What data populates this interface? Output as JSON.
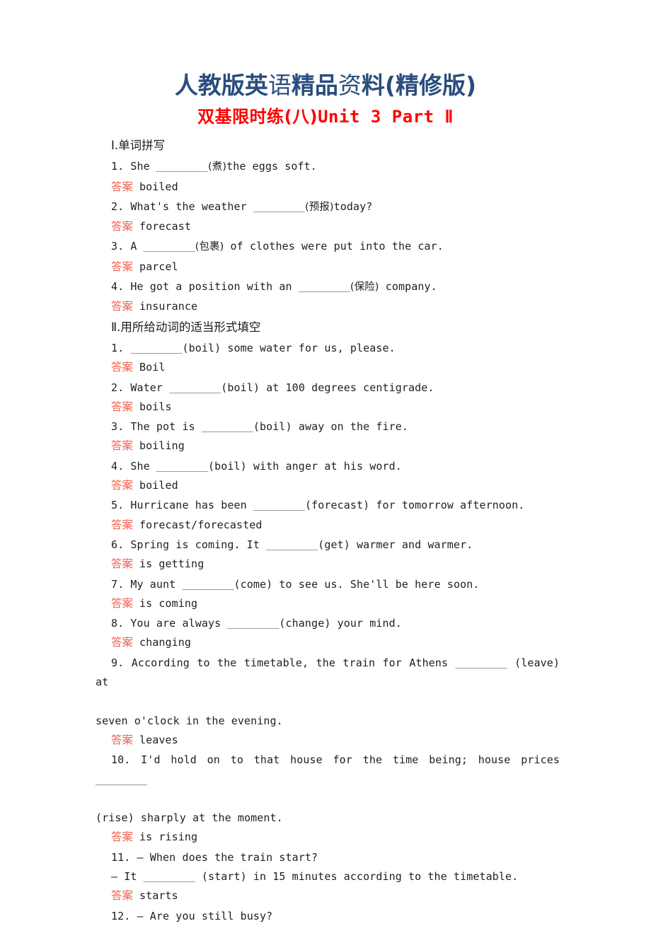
{
  "header": {
    "brand_part1": "人教版英",
    "brand_part2": "语",
    "brand_part3": "精品",
    "brand_part4": "资",
    "brand_part5": "料(精修版)",
    "brand_full": "人教版英语精品资料(精修版)",
    "exercise_title_zh": "双基限时练(八)",
    "exercise_title_en": "Unit 3  Part Ⅱ",
    "brand_color": "#2a4d7d",
    "title_color": "#ff0000",
    "answer_label_color": "#f4614f"
  },
  "sections": [
    {
      "number": "Ⅰ",
      "heading": "Ⅰ.单词拼写",
      "items": [
        {
          "q_prefix": "1. She ",
          "q_blank": "________",
          "q_mid": "(煮)",
          "q_suffix": "the eggs soft.",
          "answer_label": "答案",
          "answer": "boiled"
        },
        {
          "q_prefix": "2. What's the weather ",
          "q_blank": "________",
          "q_mid": "(预报)",
          "q_suffix": "today?",
          "answer_label": "答案",
          "answer": "forecast"
        },
        {
          "q_prefix": "3. A ",
          "q_blank": "________",
          "q_mid": "(包裹)",
          "q_suffix": " of clothes were put into the car.",
          "answer_label": "答案",
          "answer": "parcel"
        },
        {
          "q_prefix": "4. He got a position with an ",
          "q_blank": "________",
          "q_mid": "(保险)",
          "q_suffix": " company.",
          "answer_label": "答案",
          "answer": "insurance"
        }
      ]
    },
    {
      "number": "Ⅱ",
      "heading": "Ⅱ.用所给动词的适当形式填空",
      "items": [
        {
          "q_prefix": "1. ",
          "q_blank": "________",
          "q_mid": "(boil)",
          "q_suffix": " some water for us, please.",
          "answer_label": "答案",
          "answer": "Boil"
        },
        {
          "q_prefix": "2. Water ",
          "q_blank": "________",
          "q_mid": "(boil)",
          "q_suffix": " at 100 degrees centigrade.",
          "answer_label": "答案",
          "answer": "boils"
        },
        {
          "q_prefix": "3. The pot is ",
          "q_blank": "________",
          "q_mid": "(boil)",
          "q_suffix": " away on the fire.",
          "answer_label": "答案",
          "answer": "boiling"
        },
        {
          "q_prefix": "4. She ",
          "q_blank": "________",
          "q_mid": "(boil)",
          "q_suffix": " with anger at his word.",
          "answer_label": "答案",
          "answer": "boiled"
        },
        {
          "q_prefix": "5. Hurricane has been ",
          "q_blank": "________",
          "q_mid": "(forecast)",
          "q_suffix": " for tomorrow afternoon.",
          "answer_label": "答案",
          "answer": "forecast/forecasted"
        },
        {
          "q_prefix": "6. Spring is coming. It ",
          "q_blank": "________",
          "q_mid": "(get)",
          "q_suffix": " warmer and warmer.",
          "answer_label": "答案",
          "answer": "is getting"
        },
        {
          "q_prefix": "7. My aunt ",
          "q_blank": "________",
          "q_mid": "(come)",
          "q_suffix": " to see us. She'll be here soon.",
          "answer_label": "答案",
          "answer": "is coming"
        },
        {
          "q_prefix": "8. You are always ",
          "q_blank": "________",
          "q_mid": "(change)",
          "q_suffix": " your mind.",
          "answer_label": "答案",
          "answer": "changing"
        },
        {
          "q_line1_prefix": "9. According to the timetable, the train for Athens ",
          "q_line1_blank": "________",
          "q_line1_suffix": " (leave) at",
          "q_line2": "seven o'clock in the evening.",
          "answer_label": "答案",
          "answer": "leaves"
        },
        {
          "q_line1_prefix": "10. I'd hold on to that house for the time being; house prices ",
          "q_line1_blank": "________",
          "q_line2": "(rise) sharply at the moment.",
          "answer_label": "答案",
          "answer": "is rising"
        },
        {
          "q_line1": "11. — When does the train start?",
          "q_line2_prefix": "— It ",
          "q_line2_blank": "________",
          "q_line2_suffix": " (start) in 15 minutes according to the timetable.",
          "answer_label": "答案",
          "answer": "starts"
        },
        {
          "q_line1": "12. — Are you still busy?"
        }
      ]
    }
  ]
}
